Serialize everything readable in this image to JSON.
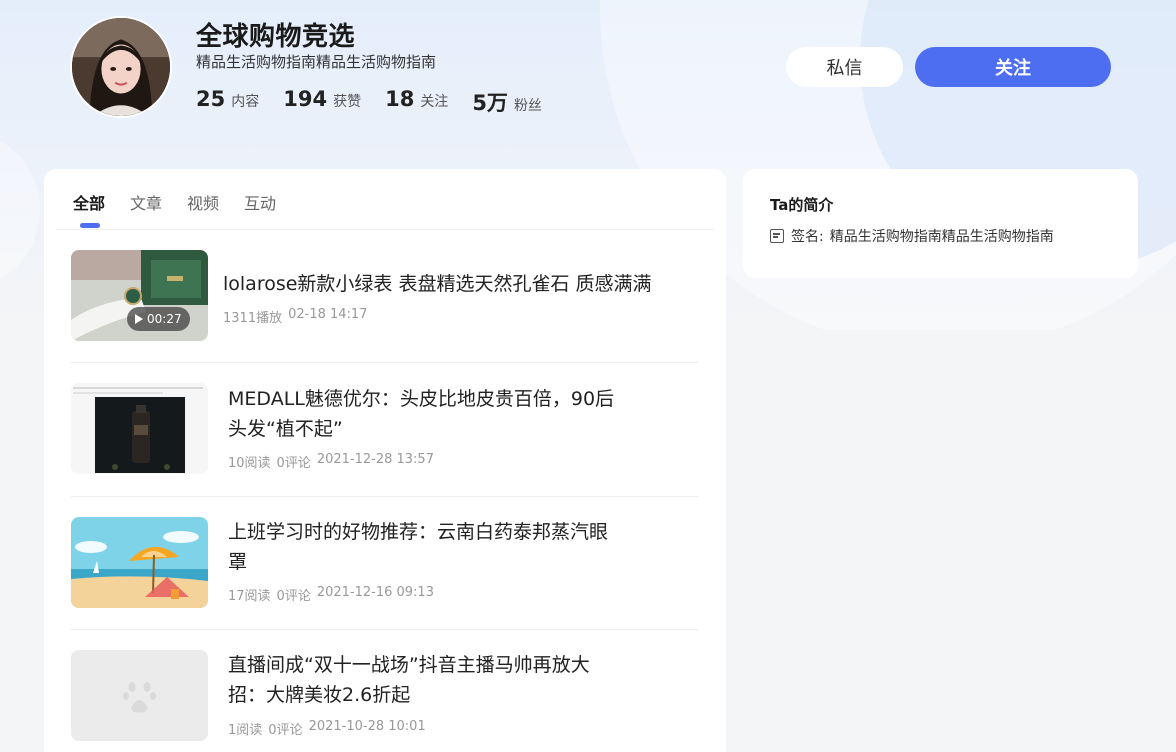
{
  "profile": {
    "name": "全球购物竞选",
    "bio": "精品生活购物指南精品生活购物指南",
    "stats": [
      {
        "value": "25",
        "label": "内容"
      },
      {
        "value": "194",
        "label": "获赞"
      },
      {
        "value": "18",
        "label": "关注"
      },
      {
        "value": "5万",
        "label": "粉丝"
      }
    ]
  },
  "actions": {
    "message_label": "私信",
    "follow_label": "关注"
  },
  "tabs": [
    {
      "label": "全部",
      "active": true
    },
    {
      "label": "文章",
      "active": false
    },
    {
      "label": "视频",
      "active": false
    },
    {
      "label": "互动",
      "active": false
    }
  ],
  "feed": [
    {
      "title_lines": [
        "lolarose新款小绿表 表盘精选天然孔雀石 质感满满"
      ],
      "meta": [
        "1311播放",
        "02-18 14:17"
      ],
      "duration": "00:27",
      "thumb": "watch-video"
    },
    {
      "title_lines": [
        "MEDALL魅德优尔：头皮比地皮贵百倍，90后",
        "头发“植不起”"
      ],
      "meta": [
        "10阅读",
        "0评论",
        "2021-12-28 13:57"
      ],
      "thumb": "product-bottle"
    },
    {
      "title_lines": [
        "上班学习时的好物推荐：云南白药泰邦蒸汽眼",
        "罩"
      ],
      "meta": [
        "17阅读",
        "0评论",
        "2021-12-16 09:13"
      ],
      "thumb": "beach-illustration"
    },
    {
      "title_lines": [
        "直播间成“双十一战场”抖音主播马帅再放大",
        "招：大牌美妆2.6折起"
      ],
      "meta": [
        "1阅读",
        "0评论",
        "2021-10-28 10:01"
      ],
      "thumb": "placeholder-paw"
    }
  ],
  "about": {
    "title": "Ta的简介",
    "sign_label": "签名:",
    "sign_text": "精品生活购物指南精品生活购物指南"
  },
  "colors": {
    "accent": "#4e6ef2"
  }
}
